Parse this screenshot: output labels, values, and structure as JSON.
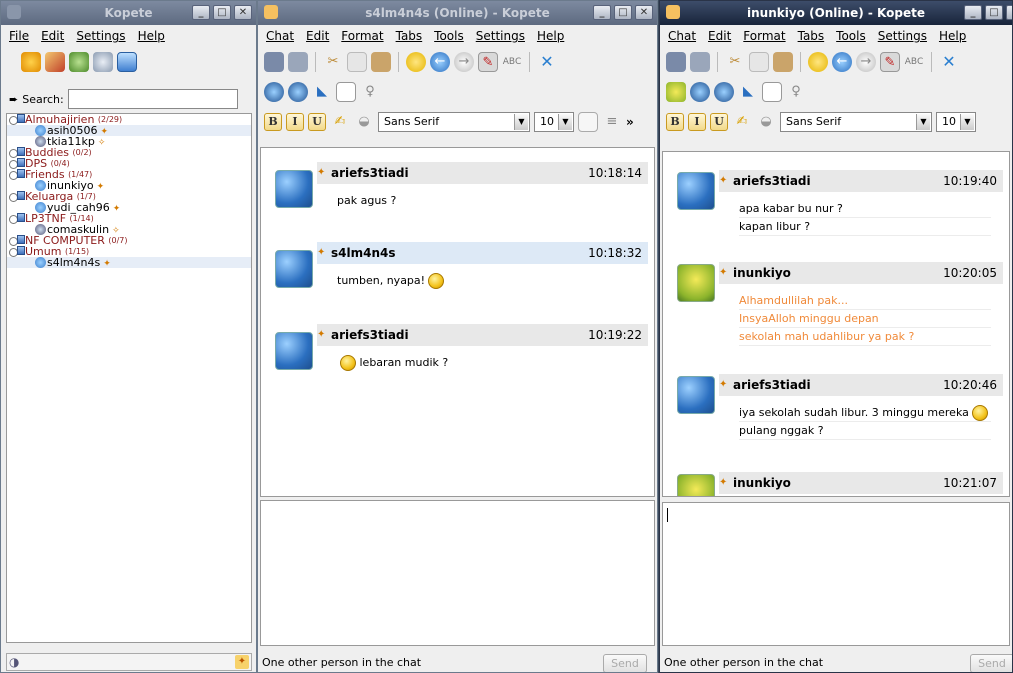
{
  "contact_window": {
    "title": "Kopete",
    "menu": [
      "File",
      "Edit",
      "Settings",
      "Help"
    ],
    "search_label": "Search:",
    "search_value": "",
    "groups": [
      {
        "name": "Almuhajirien",
        "count": "(2/29)",
        "contacts": [
          {
            "name": "asih0506",
            "status": "online",
            "selected": true
          },
          {
            "name": "tkia11kp",
            "status": "away",
            "selected": false
          }
        ]
      },
      {
        "name": "Buddies",
        "count": "(0/2)",
        "contacts": []
      },
      {
        "name": "DPS",
        "count": "(0/4)",
        "contacts": []
      },
      {
        "name": "Friends",
        "count": "(1/47)",
        "contacts": [
          {
            "name": "inunkiyo",
            "status": "online",
            "selected": false
          }
        ]
      },
      {
        "name": "Keluarga",
        "count": "(1/7)",
        "contacts": [
          {
            "name": "yudi_cah96",
            "status": "online",
            "selected": false
          }
        ]
      },
      {
        "name": "LP3TNF",
        "count": "(1/14)",
        "contacts": [
          {
            "name": "comaskulin",
            "status": "away",
            "selected": false
          }
        ]
      },
      {
        "name": "NF COMPUTER",
        "count": "(0/7)",
        "contacts": []
      },
      {
        "name": "Umum",
        "count": "(1/15)",
        "contacts": [
          {
            "name": "s4lm4n4s",
            "status": "online",
            "selected": true
          }
        ]
      }
    ]
  },
  "chat1": {
    "title": "s4lm4n4s (Online) - Kopete",
    "menu": [
      "Chat",
      "Edit",
      "Format",
      "Tabs",
      "Tools",
      "Settings",
      "Help"
    ],
    "font": "Sans Serif",
    "font_size": "10",
    "messages": [
      {
        "sender": "ariefs3tiadi",
        "time": "10:18:14",
        "lines": [
          "pak agus ?"
        ],
        "emoticon": false
      },
      {
        "sender": "s4lm4n4s",
        "time": "10:18:32",
        "lines": [
          "tumben, nyapa!"
        ],
        "emoticon": true
      },
      {
        "sender": "ariefs3tiadi",
        "time": "10:19:22",
        "lines": [
          "lebaran mudik ?"
        ],
        "emoticon": true
      }
    ],
    "status": "One other person in the chat",
    "send_label": "Send"
  },
  "chat2": {
    "title": "inunkiyo (Online) - Kopete",
    "menu": [
      "Chat",
      "Edit",
      "Format",
      "Tabs",
      "Tools",
      "Settings",
      "Help"
    ],
    "font": "Sans Serif",
    "font_size": "10",
    "messages": [
      {
        "sender": "ariefs3tiadi",
        "time": "10:19:40",
        "lines": [
          "apa kabar bu nur ?",
          "kapan libur ?"
        ]
      },
      {
        "sender": "inunkiyo",
        "time": "10:20:05",
        "lines": [
          "Alhamdullilah pak...",
          "InsyaAlloh minggu depan",
          "sekolah mah udahlibur ya pak ?"
        ]
      },
      {
        "sender": "ariefs3tiadi",
        "time": "10:20:46",
        "lines": [
          "iya sekolah sudah libur. 3 minggu mereka",
          "pulang nggak ?"
        ]
      },
      {
        "sender": "inunkiyo",
        "time": "10:21:07",
        "lines": []
      }
    ],
    "status": "One other person in the chat",
    "send_label": "Send"
  }
}
